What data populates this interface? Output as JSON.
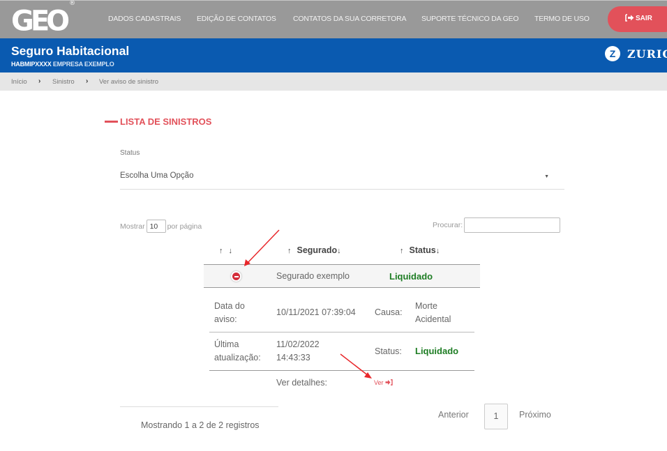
{
  "topbar": {
    "logo": "GEO",
    "logo_mark": "®",
    "nav": [
      {
        "label": "DADOS CADASTRAIS"
      },
      {
        "label": "EDIÇÃO DE CONTATOS"
      },
      {
        "label": "CONTATOS DA SUA CORRETORA"
      },
      {
        "label": "SUPORTE TÉCNICO DA GEO"
      },
      {
        "label": "TERMO DE USO"
      }
    ],
    "logout_label": "SAIR",
    "logout_icon": "sign-out-icon"
  },
  "header": {
    "title": "Seguro Habitacional",
    "code": "HABMIPXXXX",
    "company": "EMPRESA EXEMPLO",
    "brand": "ZURICH",
    "brand_mark": "Z"
  },
  "breadcrumb": {
    "items": [
      "Início",
      "Sinistro",
      "Ver aviso de sinistro"
    ],
    "separator": "›"
  },
  "section": {
    "title": "LISTA DE SINISTROS"
  },
  "filter": {
    "status_label": "Status",
    "status_value": "Escolha Uma Opção"
  },
  "table_controls": {
    "show_prefix": "Mostrar",
    "show_value": "10",
    "show_suffix": "por página",
    "search_label": "Procurar:",
    "search_value": ""
  },
  "table": {
    "headers": [
      {
        "label": "",
        "sort_up": "↑",
        "sort_down": "↓"
      },
      {
        "label": "Segurado",
        "sort_up": "↑",
        "sort_down": "↓"
      },
      {
        "label": "Status",
        "sort_up": "↑",
        "sort_down": "↓"
      }
    ],
    "rows": [
      {
        "segurado": "Segurado exemplo",
        "status": "Liquidado"
      }
    ],
    "details": {
      "data_aviso_label": "Data do aviso:",
      "data_aviso_l1": "Data do",
      "data_aviso_l2": "aviso:",
      "data_aviso_value": "10/11/2021 07:39:04",
      "causa_label": "Causa:",
      "causa_l1": "Morte",
      "causa_l2": "Acidental",
      "ultima_l1": "Última",
      "ultima_l2": "atualização:",
      "ultima_date": "11/02/2022",
      "ultima_time": "14:43:33",
      "status_label": "Status:",
      "status_value": "Liquidado",
      "ver_detalhes_label": "Ver detalhes:",
      "ver_link": "Ver"
    }
  },
  "footer": {
    "summary": "Mostrando 1 a 2 de 2 registros",
    "prev": "Anterior",
    "page": "1",
    "next": "Próximo"
  },
  "colors": {
    "accent": "#e2515a",
    "header_blue": "#0a5ab0",
    "status_green": "#1e7d24",
    "topbar_gray": "#999999"
  }
}
